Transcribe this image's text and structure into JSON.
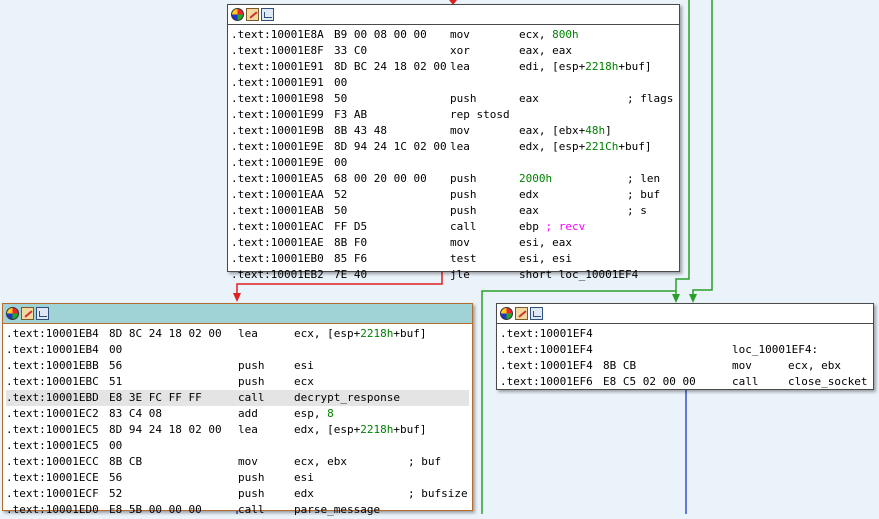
{
  "colors": {
    "true_edge": "#2aa02a",
    "false_edge": "#e02020",
    "normal_edge": "#3050d0",
    "node_border": "#4a4a4a",
    "selected_header": "#9fd3d6",
    "background": "#eaf3fa"
  },
  "node_header_icons": [
    "color-icon",
    "rename-icon",
    "graph-icon"
  ],
  "nodes": {
    "top": {
      "lines": [
        {
          "addr": ".text:10001E8A",
          "bytes": "B9 00 08 00 00",
          "mn": "mov",
          "op": "ecx, ",
          "op_num": "800h",
          "op_rest": "",
          "cmt": ""
        },
        {
          "addr": ".text:10001E8F",
          "bytes": "33 C0",
          "mn": "xor",
          "op": "eax, eax",
          "op_num": "",
          "op_rest": "",
          "cmt": ""
        },
        {
          "addr": ".text:10001E91",
          "bytes": "8D BC 24 18 02 00",
          "mn": "lea",
          "op": "edi, [esp+",
          "op_num": "2218h",
          "op_rest": "+buf]",
          "cmt": ""
        },
        {
          "addr": ".text:10001E91",
          "bytes": "00",
          "mn": "",
          "op": "",
          "op_num": "",
          "op_rest": "",
          "cmt": ""
        },
        {
          "addr": ".text:10001E98",
          "bytes": "50",
          "mn": "push",
          "op": "eax",
          "op_num": "",
          "op_rest": "",
          "cmt": "; flags"
        },
        {
          "addr": ".text:10001E99",
          "bytes": "F3 AB",
          "mn": "rep stosd",
          "op": "",
          "op_num": "",
          "op_rest": "",
          "cmt": ""
        },
        {
          "addr": ".text:10001E9B",
          "bytes": "8B 43 48",
          "mn": "mov",
          "op": "eax, [ebx+",
          "op_num": "48h",
          "op_rest": "]",
          "cmt": ""
        },
        {
          "addr": ".text:10001E9E",
          "bytes": "8D 94 24 1C 02 00",
          "mn": "lea",
          "op": "edx, [esp+",
          "op_num": "221Ch",
          "op_rest": "+buf]",
          "cmt": ""
        },
        {
          "addr": ".text:10001E9E",
          "bytes": "00",
          "mn": "",
          "op": "",
          "op_num": "",
          "op_rest": "",
          "cmt": ""
        },
        {
          "addr": ".text:10001EA5",
          "bytes": "68 00 20 00 00",
          "mn": "push",
          "op": "",
          "op_num": "2000h",
          "op_rest": "",
          "cmt": "; len"
        },
        {
          "addr": ".text:10001EAA",
          "bytes": "52",
          "mn": "push",
          "op": "edx",
          "op_num": "",
          "op_rest": "",
          "cmt": "; buf"
        },
        {
          "addr": ".text:10001EAB",
          "bytes": "50",
          "mn": "push",
          "op": "eax",
          "op_num": "",
          "op_rest": "",
          "cmt": "; s"
        },
        {
          "addr": ".text:10001EAC",
          "bytes": "FF D5",
          "mn": "call",
          "op": "ebp ",
          "op_num": "",
          "op_rest": "",
          "cmt": "",
          "pink": "; recv"
        },
        {
          "addr": ".text:10001EAE",
          "bytes": "8B F0",
          "mn": "mov",
          "op": "esi, eax",
          "op_num": "",
          "op_rest": "",
          "cmt": ""
        },
        {
          "addr": ".text:10001EB0",
          "bytes": "85 F6",
          "mn": "test",
          "op": "esi, esi",
          "op_num": "",
          "op_rest": "",
          "cmt": ""
        },
        {
          "addr": ".text:10001EB2",
          "bytes": "7E 40",
          "mn": "jle",
          "op": "short loc_10001EF4",
          "op_num": "",
          "op_rest": "",
          "cmt": ""
        }
      ]
    },
    "left": {
      "lines": [
        {
          "addr": ".text:10001EB4",
          "bytes": "8D 8C 24 18 02 00",
          "mn": "lea",
          "op": "ecx, [esp+",
          "op_num": "2218h",
          "op_rest": "+buf]",
          "cmt": ""
        },
        {
          "addr": ".text:10001EB4",
          "bytes": "00",
          "mn": "",
          "op": "",
          "op_num": "",
          "op_rest": "",
          "cmt": ""
        },
        {
          "addr": ".text:10001EBB",
          "bytes": "56",
          "mn": "push",
          "op": "esi",
          "op_num": "",
          "op_rest": "",
          "cmt": ""
        },
        {
          "addr": ".text:10001EBC",
          "bytes": "51",
          "mn": "push",
          "op": "ecx",
          "op_num": "",
          "op_rest": "",
          "cmt": ""
        },
        {
          "addr": ".text:10001EBD",
          "bytes": "E8 3E FC FF FF",
          "mn": "call",
          "op": "decrypt_response",
          "op_num": "",
          "op_rest": "",
          "cmt": "",
          "highlight": true
        },
        {
          "addr": ".text:10001EC2",
          "bytes": "83 C4 08",
          "mn": "add",
          "op": "esp, ",
          "op_num": "8",
          "op_rest": "",
          "cmt": ""
        },
        {
          "addr": ".text:10001EC5",
          "bytes": "8D 94 24 18 02 00",
          "mn": "lea",
          "op": "edx, [esp+",
          "op_num": "2218h",
          "op_rest": "+buf]",
          "cmt": ""
        },
        {
          "addr": ".text:10001EC5",
          "bytes": "00",
          "mn": "",
          "op": "",
          "op_num": "",
          "op_rest": "",
          "cmt": ""
        },
        {
          "addr": ".text:10001ECC",
          "bytes": "8B CB",
          "mn": "mov",
          "op": "ecx, ebx",
          "op_num": "",
          "op_rest": "",
          "cmt": "; buf"
        },
        {
          "addr": ".text:10001ECE",
          "bytes": "56",
          "mn": "push",
          "op": "esi",
          "op_num": "",
          "op_rest": "",
          "cmt": ""
        },
        {
          "addr": ".text:10001ECF",
          "bytes": "52",
          "mn": "push",
          "op": "edx",
          "op_num": "",
          "op_rest": "",
          "cmt": "; bufsize"
        },
        {
          "addr": ".text:10001ED0",
          "bytes": "E8 5B 00 00 00",
          "mn": "call",
          "op": "parse_message",
          "op_num": "",
          "op_rest": "",
          "cmt": ""
        }
      ]
    },
    "right": {
      "lines": [
        {
          "addr": ".text:10001EF4",
          "bytes": "",
          "mn": "",
          "op": "",
          "op_num": "",
          "op_rest": "",
          "cmt": ""
        },
        {
          "addr": ".text:10001EF4",
          "bytes": "",
          "mn": "",
          "op": "",
          "op_num": "",
          "op_rest": "",
          "cmt": "",
          "label": "loc_10001EF4:"
        },
        {
          "addr": ".text:10001EF4",
          "bytes": "8B CB",
          "mn": "mov",
          "op": "ecx, ebx",
          "op_num": "",
          "op_rest": "",
          "cmt": ""
        },
        {
          "addr": ".text:10001EF6",
          "bytes": "E8 C5 02 00 00",
          "mn": "call",
          "op": "close_socket",
          "op_num": "",
          "op_rest": "",
          "cmt": ""
        }
      ]
    }
  }
}
